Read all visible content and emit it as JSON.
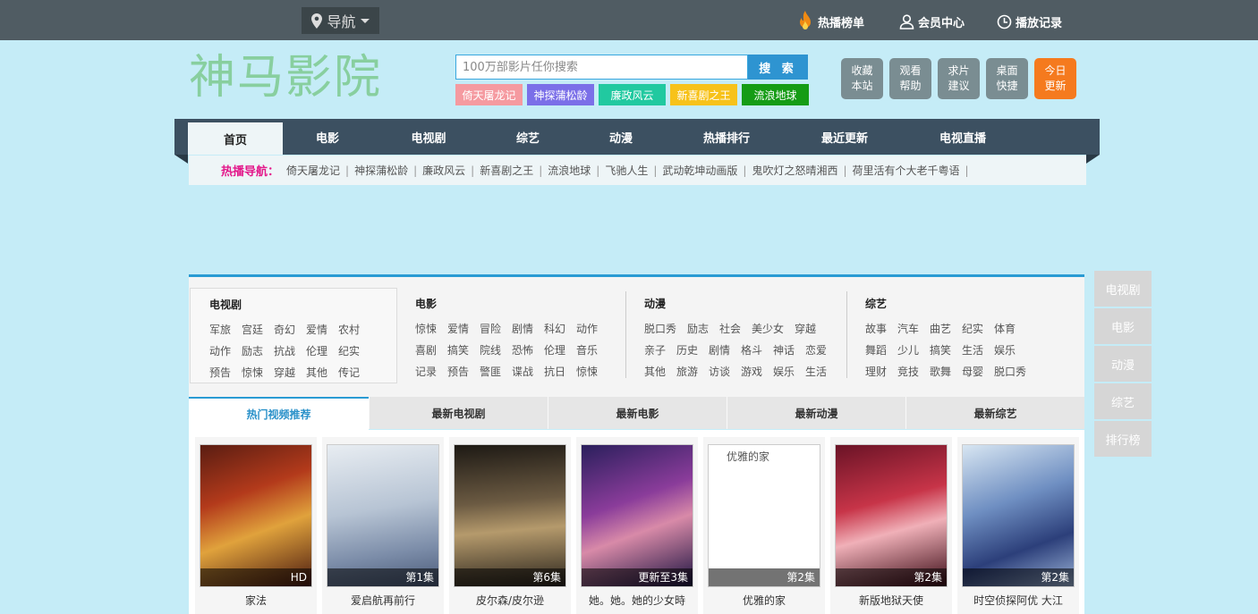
{
  "topbar": {
    "nav_label": "导航",
    "links": [
      {
        "label": "热播榜单",
        "icon": "flame-icon"
      },
      {
        "label": "会员中心",
        "icon": "user-icon"
      },
      {
        "label": "播放记录",
        "icon": "clock-icon"
      }
    ]
  },
  "header": {
    "logo": "神马影院",
    "search": {
      "placeholder": "100万部影片任你搜索",
      "button": "搜 索"
    },
    "tags": [
      {
        "label": "倚天屠龙记",
        "color": "#f59aa0"
      },
      {
        "label": "神探蒲松龄",
        "color": "#7b6fe8"
      },
      {
        "label": "廉政风云",
        "color": "#21c9a0"
      },
      {
        "label": "新喜剧之王",
        "color": "#f7c21a"
      },
      {
        "label": "流浪地球",
        "color": "#159c15"
      }
    ],
    "quick": [
      {
        "l1": "收藏",
        "l2": "本站"
      },
      {
        "l1": "观看",
        "l2": "帮助"
      },
      {
        "l1": "求片",
        "l2": "建议"
      },
      {
        "l1": "桌面",
        "l2": "快捷"
      },
      {
        "l1": "今日",
        "l2": "更新"
      }
    ]
  },
  "mainnav": [
    "首页",
    "电影",
    "电视剧",
    "综艺",
    "动漫",
    "热播排行",
    "最近更新",
    "电视直播"
  ],
  "hotnav": {
    "label": "热播导航：",
    "items": [
      "倚天屠龙记",
      "神探蒲松龄",
      "廉政风云",
      "新喜剧之王",
      "流浪地球",
      "飞驰人生",
      "武动乾坤动画版",
      "鬼吹灯之怒晴湘西",
      "荷里活有个大老千粤语"
    ]
  },
  "categories": {
    "tv": {
      "title": "电视剧",
      "rows": [
        [
          "军旅",
          "宫廷",
          "奇幻",
          "爱情",
          "农村"
        ],
        [
          "动作",
          "励志",
          "抗战",
          "伦理",
          "纪实"
        ],
        [
          "预告",
          "惊悚",
          "穿越",
          "其他",
          "传记"
        ]
      ]
    },
    "movie": {
      "title": "电影",
      "rows": [
        [
          "惊悚",
          "爱情",
          "冒险",
          "剧情",
          "科幻",
          "动作"
        ],
        [
          "喜剧",
          "搞笑",
          "院线",
          "恐怖",
          "伦理",
          "音乐"
        ],
        [
          "记录",
          "预告",
          "警匪",
          "谍战",
          "抗日",
          "惊悚"
        ]
      ]
    },
    "anime": {
      "title": "动漫",
      "rows": [
        [
          "脱口秀",
          "励志",
          "社会",
          "美少女",
          "穿越"
        ],
        [
          "亲子",
          "历史",
          "剧情",
          "格斗",
          "神话",
          "恋爱"
        ],
        [
          "其他",
          "旅游",
          "访谈",
          "游戏",
          "娱乐",
          "生活"
        ]
      ]
    },
    "variety": {
      "title": "综艺",
      "rows": [
        [
          "故事",
          "汽车",
          "曲艺",
          "纪实",
          "体育"
        ],
        [
          "舞蹈",
          "少儿",
          "搞笑",
          "生活",
          "娱乐"
        ],
        [
          "理财",
          "竞技",
          "歌舞",
          "母婴",
          "脱口秀"
        ]
      ]
    }
  },
  "tabs": [
    "热门视频推荐",
    "最新电视剧",
    "最新电影",
    "最新动漫",
    "最新综艺"
  ],
  "videos": [
    {
      "title": "家法",
      "badge": "HD"
    },
    {
      "title": "爱启航再前行",
      "badge": "第1集"
    },
    {
      "title": "皮尔森/皮尔逊",
      "badge": "第6集"
    },
    {
      "title": "她。她。她的少女時",
      "badge": "更新至3集"
    },
    {
      "title": "优雅的家",
      "badge": "第2集",
      "alt": "优雅的家"
    },
    {
      "title": "新版地狱天使",
      "badge": "第2集"
    },
    {
      "title": "时空侦探阿优 大江",
      "badge": "第2集"
    }
  ],
  "side": [
    "电视剧",
    "电影",
    "动漫",
    "综艺",
    "排行榜"
  ]
}
